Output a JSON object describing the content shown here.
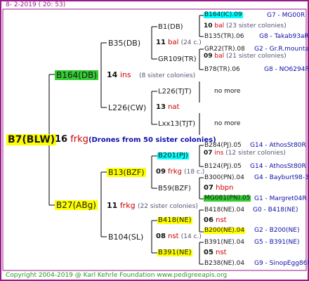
{
  "header": "8-  2-2019 ( 20: 53)",
  "footer": "Copyright 2004-2019 @ Karl Kehrle Foundation    www.pedigreeapis.org",
  "root": {
    "id": "B7(BLW)",
    "num": "16",
    "year": "frkg",
    "note": "(Drones from 50 sister colonies)"
  },
  "gen2": [
    {
      "id": "B164(DB)",
      "num": "14",
      "year": "ins",
      "note": "(8 sister colonies)"
    },
    {
      "id": "B27(ABg)",
      "num": "11",
      "year": "frkg",
      "note": "(22 sister colonies)"
    }
  ],
  "gen3": [
    {
      "id": "B35(DB)"
    },
    {
      "id": "L226(CW)",
      "num": "13",
      "year": "nat"
    },
    {
      "id": "B13(BZF)",
      "num": "09",
      "year": "frkg",
      "note": "(18 c.)"
    },
    {
      "id": "B104(SL)",
      "num": "08",
      "year": "nst",
      "note": "(14 c.)"
    }
  ],
  "gen4": [
    {
      "id": "B1(DB)",
      "num": "11",
      "year": "bal",
      "note": "(24 c.)"
    },
    {
      "id": "GR109(TR)",
      "num": "09",
      "year": "bal",
      "note": "(21 sister colonies)"
    },
    {
      "id": "L226(TJT)",
      "num": "13",
      "year": "nat"
    },
    {
      "id": "Lxx13(TJT)"
    },
    {
      "id": "B201(PJ)",
      "num": "07",
      "year": "ins",
      "note": "(12 sister colonies)"
    },
    {
      "id": "B59(BZF)",
      "num": "07",
      "year": "hbpn"
    },
    {
      "id": "B418(NE)",
      "num": "06",
      "year": "nst"
    },
    {
      "id": "B391(NE)",
      "num": "05",
      "year": "nst"
    }
  ],
  "gen5": [
    {
      "id": "B164(IC).09",
      "right": "G7 - MG00R"
    },
    {
      "num": "10",
      "year": "bal",
      "note": "(23 sister colonies)"
    },
    {
      "id": "B135(TR).06",
      "right": "G8 - Takab93aR"
    },
    {
      "id": "GR22(TR).08",
      "right": "G2 - Gr.R.mounta"
    },
    {
      "id": "B78(TR).06",
      "right": "G8 - NO6294R"
    },
    {
      "right": "no more"
    },
    {
      "right": "no more"
    },
    {
      "id": "B284(PJ).05",
      "right": "G14 - AthosSt80R"
    },
    {
      "id": "B124(PJ).05",
      "right": "G14 - AthosSt80R"
    },
    {
      "id": "B300(PN).04",
      "right": "G4 - Bayburt98-3"
    },
    {
      "id": "MG081(PN).05",
      "right": "G1 - Margret04R"
    },
    {
      "id": "B418(NE).04",
      "right": "G0 - B418(NE)"
    },
    {
      "id": "B200(NE).04",
      "right": "G2 - B200(NE)"
    },
    {
      "id": "B391(NE).04",
      "right": "G5 - B391(NE)"
    },
    {
      "id": "B238(NE).04",
      "right": "G9 - SinopEgg86R"
    }
  ],
  "colors": {
    "frame": "#9a1a8a",
    "highlight_yellow": "#ffff00",
    "highlight_green": "#33cc33",
    "highlight_cyan": "#00ffff",
    "year_red": "#cc0000",
    "right_blue": "#1010aa"
  }
}
